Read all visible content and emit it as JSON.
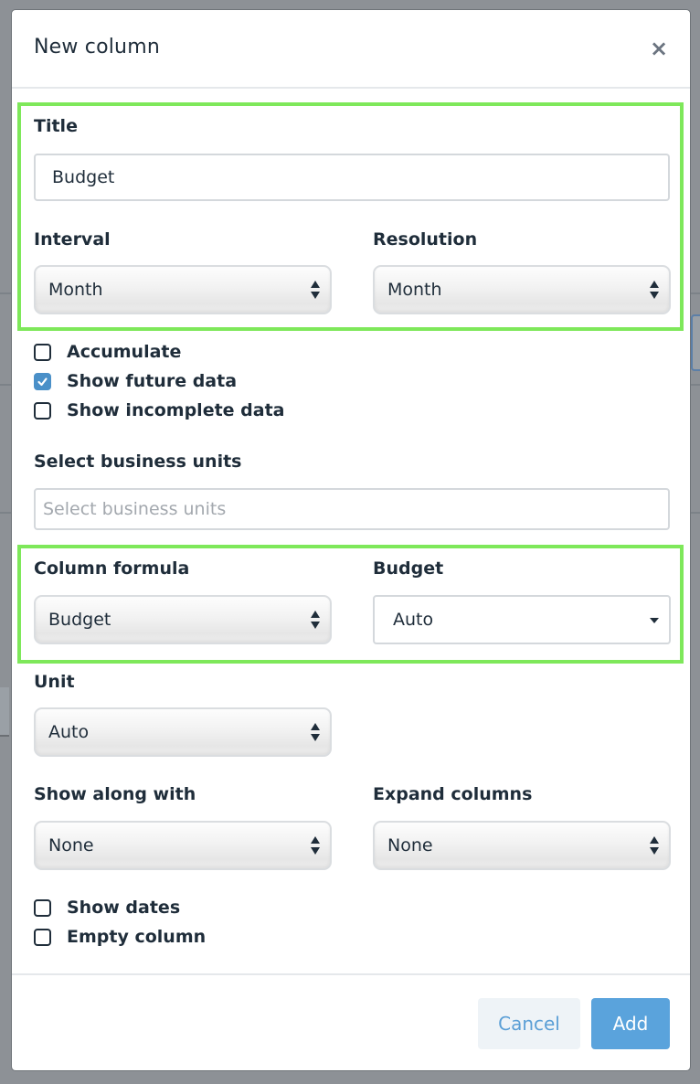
{
  "modal": {
    "title": "New column",
    "close_symbol": "×"
  },
  "title_field": {
    "label": "Title",
    "value": "Budget"
  },
  "interval": {
    "label": "Interval",
    "value": "Month"
  },
  "resolution": {
    "label": "Resolution",
    "value": "Month"
  },
  "checkboxes_top": [
    {
      "label": "Accumulate",
      "checked": false
    },
    {
      "label": "Show future data",
      "checked": true
    },
    {
      "label": "Show incomplete data",
      "checked": false
    }
  ],
  "business_units": {
    "label": "Select business units",
    "placeholder": "Select business units"
  },
  "column_formula": {
    "label": "Column formula",
    "value": "Budget"
  },
  "budget": {
    "label": "Budget",
    "value": "Auto"
  },
  "unit": {
    "label": "Unit",
    "value": "Auto"
  },
  "show_along_with": {
    "label": "Show along with",
    "value": "None"
  },
  "expand_columns": {
    "label": "Expand columns",
    "value": "None"
  },
  "checkboxes_bottom": [
    {
      "label": "Show dates",
      "checked": false
    },
    {
      "label": "Empty column",
      "checked": false
    }
  ],
  "footer": {
    "cancel_label": "Cancel",
    "add_label": "Add"
  },
  "colors": {
    "highlight": "#7ee85a",
    "primary": "#5aa3dc",
    "checkbox_checked": "#4a90c8"
  }
}
